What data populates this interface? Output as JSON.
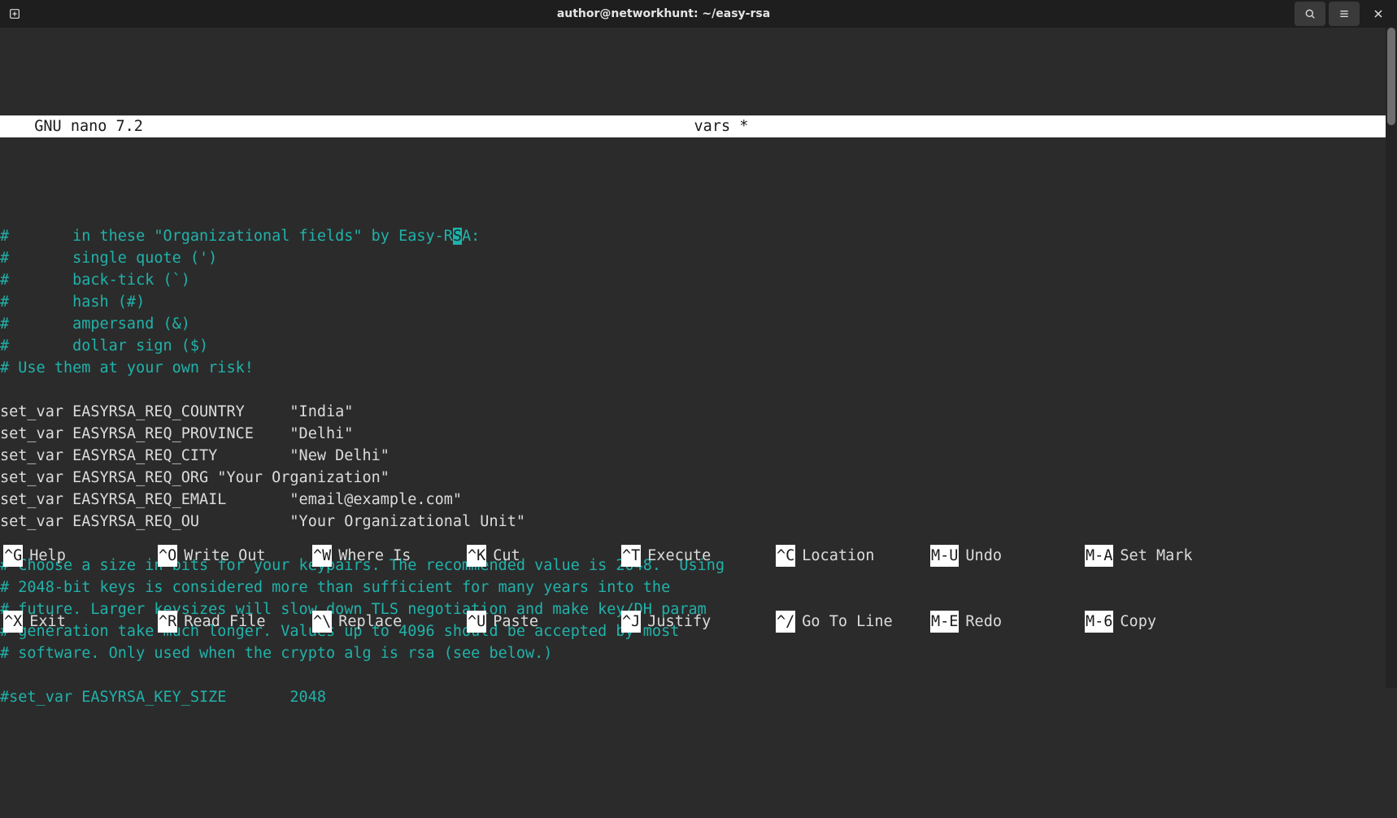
{
  "window": {
    "title": "author@networkhunt: ~/easy-rsa"
  },
  "nano": {
    "app_header": "  GNU nano 7.2",
    "file_header": "vars *"
  },
  "lines": [
    {
      "cls": "cmt",
      "text": "#       in these \"Organizational fields\" by Easy-R",
      "after_cursor": "A:",
      "cursor_char": "S"
    },
    {
      "cls": "cmt",
      "text": "#       single quote (')"
    },
    {
      "cls": "cmt",
      "text": "#       back-tick (`)"
    },
    {
      "cls": "cmt",
      "text": "#       hash (#)"
    },
    {
      "cls": "cmt",
      "text": "#       ampersand (&)"
    },
    {
      "cls": "cmt",
      "text": "#       dollar sign ($)"
    },
    {
      "cls": "cmt",
      "text": "# Use them at your own risk!"
    },
    {
      "cls": "norm",
      "text": ""
    },
    {
      "cls": "norm",
      "text": "set_var EASYRSA_REQ_COUNTRY     \"India\""
    },
    {
      "cls": "norm",
      "text": "set_var EASYRSA_REQ_PROVINCE    \"Delhi\""
    },
    {
      "cls": "norm",
      "text": "set_var EASYRSA_REQ_CITY        \"New Delhi\""
    },
    {
      "cls": "norm",
      "text": "set_var EASYRSA_REQ_ORG \"Your Organization\""
    },
    {
      "cls": "norm",
      "text": "set_var EASYRSA_REQ_EMAIL       \"email@example.com\""
    },
    {
      "cls": "norm",
      "text": "set_var EASYRSA_REQ_OU          \"Your Organizational Unit\""
    },
    {
      "cls": "norm",
      "text": ""
    },
    {
      "cls": "cmt",
      "text": "# Choose a size in bits for your keypairs. The recommended value is 2048.  Using"
    },
    {
      "cls": "cmt",
      "text": "# 2048-bit keys is considered more than sufficient for many years into the"
    },
    {
      "cls": "cmt",
      "text": "# future. Larger keysizes will slow down TLS negotiation and make key/DH param"
    },
    {
      "cls": "cmt",
      "text": "# generation take much longer. Values up to 4096 should be accepted by most"
    },
    {
      "cls": "cmt",
      "text": "# software. Only used when the crypto alg is rsa (see below.)"
    },
    {
      "cls": "norm",
      "text": ""
    },
    {
      "cls": "cmt",
      "text": "#set_var EASYRSA_KEY_SIZE       2048"
    }
  ],
  "shortcuts_row1": [
    {
      "key": "^G",
      "desc": "Help"
    },
    {
      "key": "^O",
      "desc": "Write Out"
    },
    {
      "key": "^W",
      "desc": "Where Is"
    },
    {
      "key": "^K",
      "desc": "Cut"
    },
    {
      "key": "^T",
      "desc": "Execute"
    },
    {
      "key": "^C",
      "desc": "Location"
    },
    {
      "key": "M-U",
      "desc": "Undo"
    },
    {
      "key": "M-A",
      "desc": "Set Mark"
    }
  ],
  "shortcuts_row2": [
    {
      "key": "^X",
      "desc": "Exit"
    },
    {
      "key": "^R",
      "desc": "Read File"
    },
    {
      "key": "^\\",
      "desc": "Replace"
    },
    {
      "key": "^U",
      "desc": "Paste"
    },
    {
      "key": "^J",
      "desc": "Justify"
    },
    {
      "key": "^/",
      "desc": "Go To Line"
    },
    {
      "key": "M-E",
      "desc": "Redo"
    },
    {
      "key": "M-6",
      "desc": "Copy"
    }
  ]
}
